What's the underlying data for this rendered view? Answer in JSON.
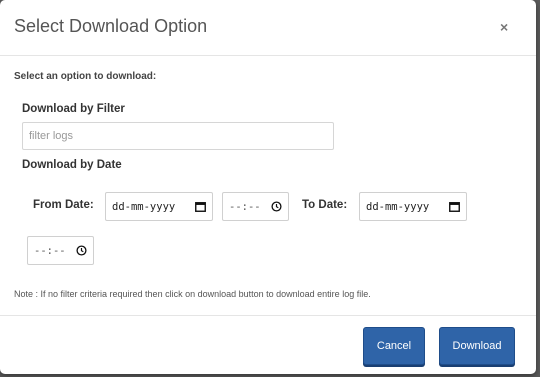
{
  "modal": {
    "title": "Select Download Option",
    "close_label": "×",
    "intro": "Select an option to download:"
  },
  "filter": {
    "heading": "Download by Filter",
    "placeholder": "filter logs",
    "value": ""
  },
  "date": {
    "heading": "Download by Date",
    "from_label": "From Date:",
    "from_date_value": "dd-mm-yyyy",
    "from_time_value": "--:--",
    "to_label": "To Date:",
    "to_date_value": "dd-mm-yyyy",
    "to_time_value": "--:--"
  },
  "note": "Note : If no filter criteria required then click on download button to download entire log file.",
  "buttons": {
    "cancel": "Cancel",
    "download": "Download"
  },
  "icons": {
    "calendar": "calendar-icon",
    "clock": "clock-icon"
  },
  "colors": {
    "primary_button": "#2f64a8",
    "backdrop": "#5a5a5a"
  }
}
